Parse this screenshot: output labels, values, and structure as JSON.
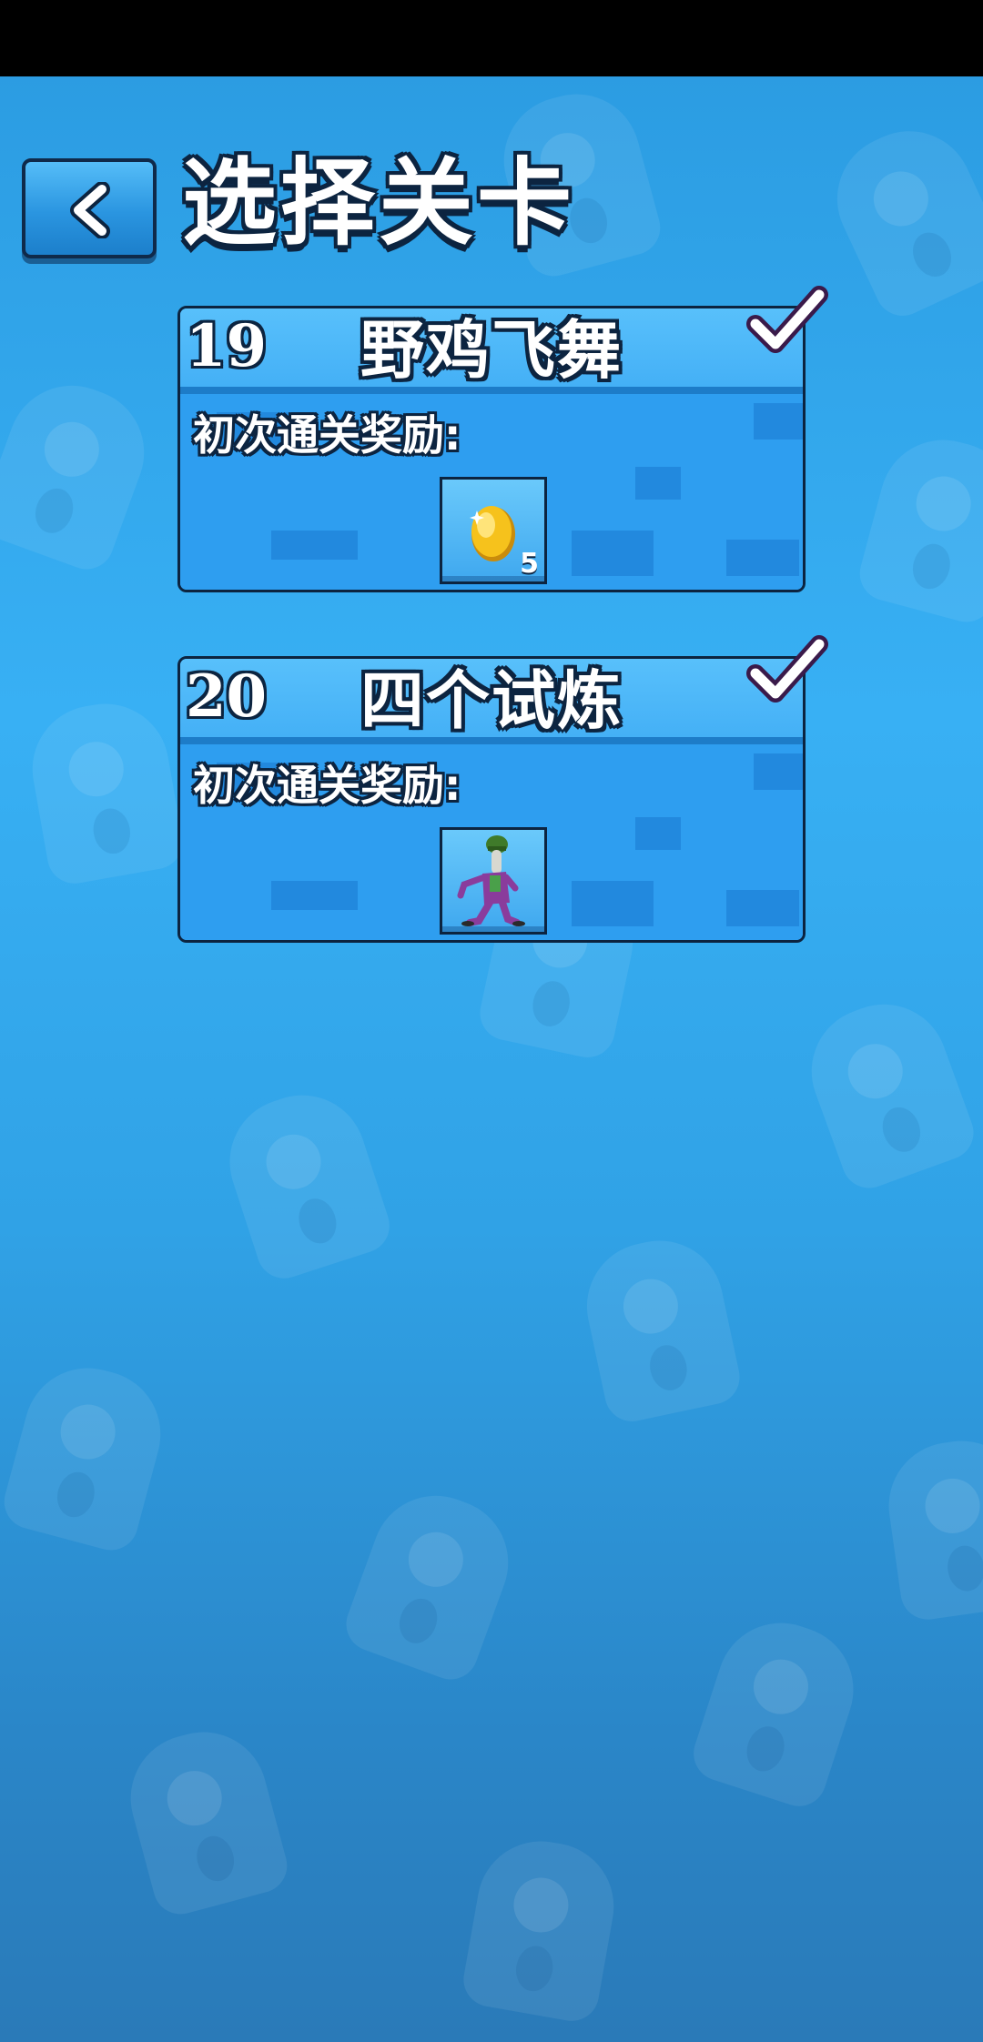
{
  "header": {
    "title": "选择关卡",
    "back_icon": "chevron-left-icon"
  },
  "levels": [
    {
      "number": "19",
      "name": "野鸡飞舞",
      "completed": true,
      "reward_label": "初次通关奖励:",
      "reward": {
        "type": "coin",
        "icon": "gold-coin-icon",
        "count": "5"
      }
    },
    {
      "number": "20",
      "name": "四个试炼",
      "completed": true,
      "reward_label": "初次通关奖励:",
      "reward": {
        "type": "character",
        "icon": "dancing-character-icon",
        "count": ""
      }
    }
  ],
  "colors": {
    "background": "#38b0f4",
    "card": "#2f9ff0",
    "card_header": "#58c0fb",
    "outline": "#0c2440",
    "check_fill": "#ffffff",
    "check_outline": "#3a1a4a",
    "coin": "#f6c21c"
  }
}
